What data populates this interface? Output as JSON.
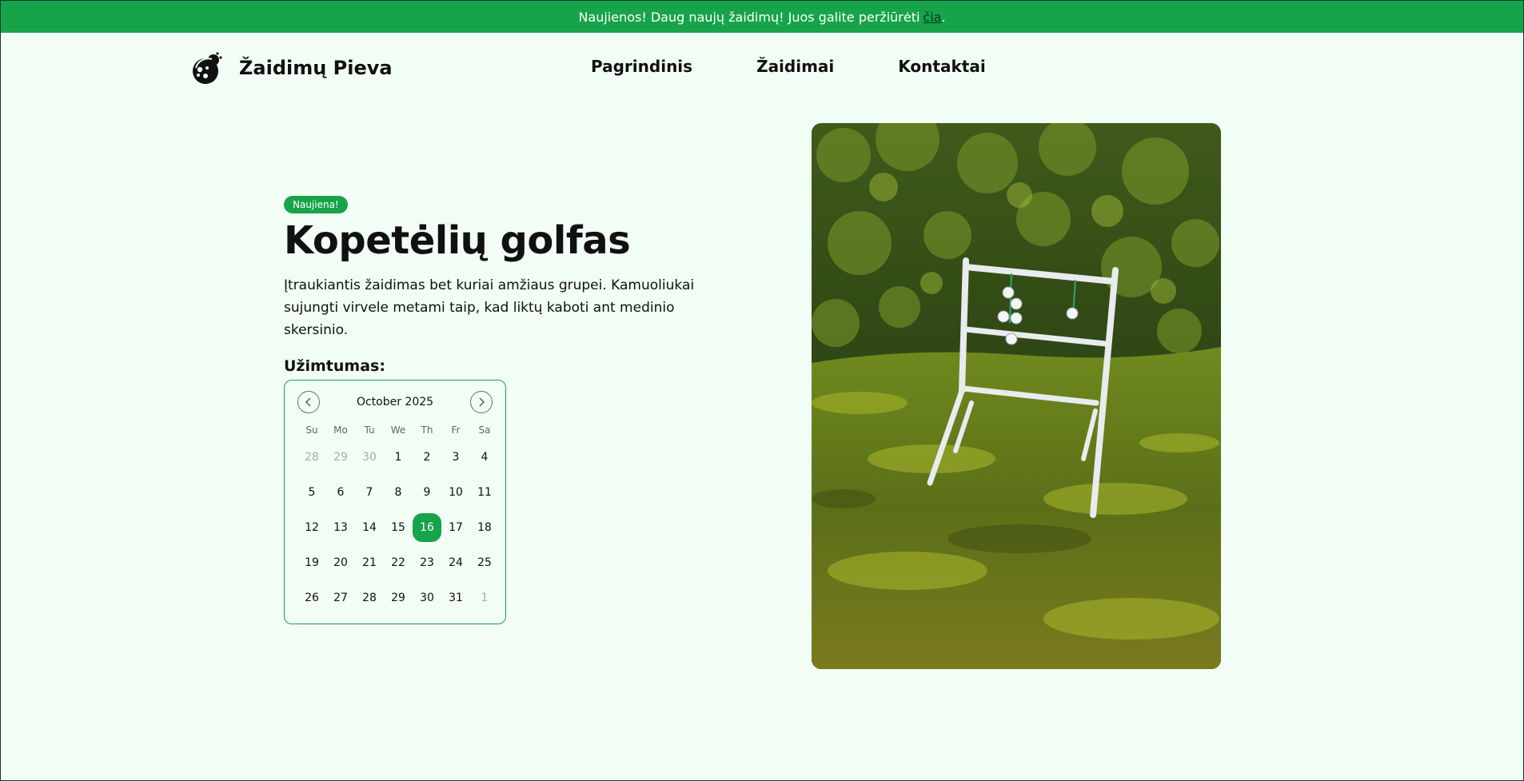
{
  "banner": {
    "text": "Naujienos! Daug naujų žaidimų! Juos galite peržiūrėti ",
    "link": "čia",
    "end": "."
  },
  "header": {
    "logo_text": "Žaidimų Pieva",
    "nav": [
      "Pagrindinis",
      "Žaidimai",
      "Kontaktai"
    ]
  },
  "hero": {
    "badge": "Naujiena!",
    "title": "Kopetėlių golfas",
    "description": "Įtraukiantis žaidimas bet kuriai amžiaus grupei. Kamuoliukai sujungti virvele metami taip, kad liktų kaboti ant medinio skersinio.",
    "occupancy_label": "Užimtumas:"
  },
  "calendar": {
    "month_label": "October 2025",
    "prev_icon": "chevron-left-icon",
    "next_icon": "chevron-right-icon",
    "weekdays": [
      "Su",
      "Mo",
      "Tu",
      "We",
      "Th",
      "Fr",
      "Sa"
    ],
    "days": [
      {
        "d": "28",
        "muted": true
      },
      {
        "d": "29",
        "muted": true
      },
      {
        "d": "30",
        "muted": true
      },
      {
        "d": "1"
      },
      {
        "d": "2"
      },
      {
        "d": "3"
      },
      {
        "d": "4"
      },
      {
        "d": "5"
      },
      {
        "d": "6"
      },
      {
        "d": "7"
      },
      {
        "d": "8"
      },
      {
        "d": "9"
      },
      {
        "d": "10"
      },
      {
        "d": "11"
      },
      {
        "d": "12"
      },
      {
        "d": "13"
      },
      {
        "d": "14"
      },
      {
        "d": "15"
      },
      {
        "d": "16",
        "selected": true
      },
      {
        "d": "17"
      },
      {
        "d": "18"
      },
      {
        "d": "19"
      },
      {
        "d": "20"
      },
      {
        "d": "21"
      },
      {
        "d": "22"
      },
      {
        "d": "23"
      },
      {
        "d": "24"
      },
      {
        "d": "25"
      },
      {
        "d": "26"
      },
      {
        "d": "27"
      },
      {
        "d": "28"
      },
      {
        "d": "29"
      },
      {
        "d": "30"
      },
      {
        "d": "31"
      },
      {
        "d": "1",
        "muted": true
      }
    ]
  },
  "colors": {
    "accent": "#16a34a",
    "background": "#f2fdf6"
  }
}
